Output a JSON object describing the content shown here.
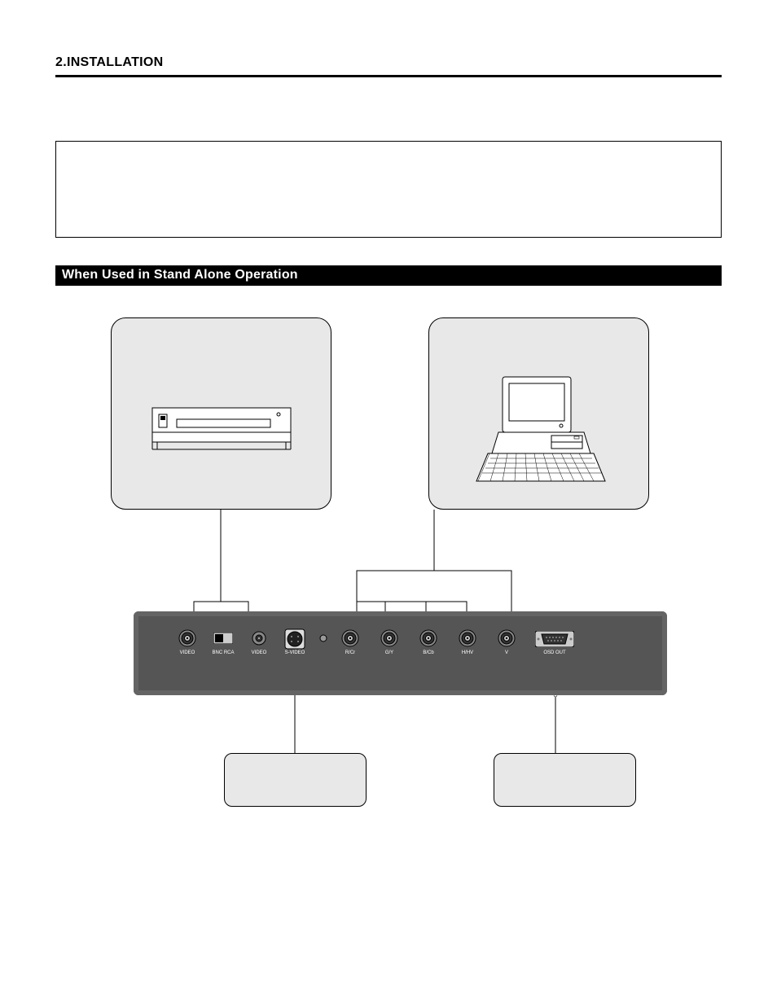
{
  "header": "2.INSTALLATION",
  "bar_title": "When Used in Stand Alone Operation",
  "ports": {
    "p1": "VIDEO",
    "p2": "BNC RCA",
    "p3": "VIDEO",
    "p4": "S-VIDEO",
    "p5": "R/Cr",
    "p6": "G/Y",
    "p7": "B/Cb",
    "p8": "H/HV",
    "p9": "V",
    "p10": "OSD OUT"
  }
}
